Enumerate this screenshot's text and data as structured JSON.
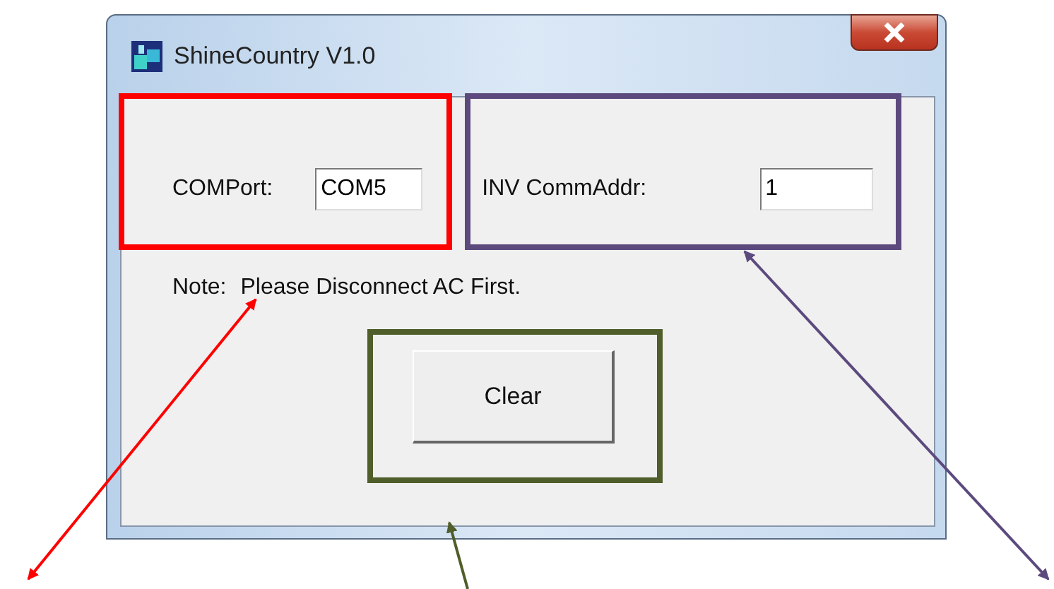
{
  "window": {
    "title": "ShineCountry V1.0"
  },
  "fields": [
    {
      "label": "COMPort:",
      "value": "COM5"
    },
    {
      "label": "INV CommAddr:",
      "value": "1"
    }
  ],
  "note": {
    "label": "Note:",
    "text": "Please Disconnect AC First."
  },
  "buttons": [
    "Clear"
  ],
  "annotations": [
    {
      "kind": "box",
      "color": "#ff0000"
    },
    {
      "kind": "box",
      "color": "#5c4a7e"
    },
    {
      "kind": "box",
      "color": "#4f5e2a"
    },
    {
      "kind": "arrow",
      "color": "#ff0000"
    },
    {
      "kind": "arrow",
      "color": "#5c4a7e"
    },
    {
      "kind": "arrow",
      "color": "#4f5e2a"
    }
  ]
}
